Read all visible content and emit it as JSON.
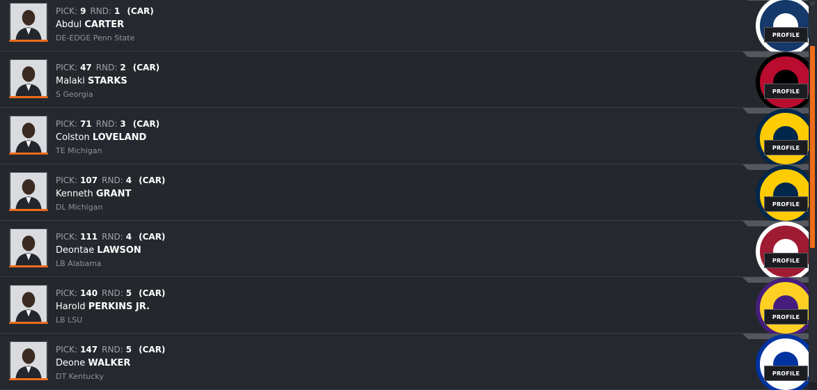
{
  "labels": {
    "pick": "PICK:",
    "round": "RND:",
    "profile": "PROFILE"
  },
  "picks": [
    {
      "pick": "9",
      "round": "1",
      "team": "(CAR)",
      "first": "Abdul",
      "last": "CARTER",
      "pos_school": "DE-EDGE Penn State",
      "logo_icon": "penn-state-logo-icon",
      "colors": {
        "primary": "#14396a",
        "secondary": "#ffffff"
      }
    },
    {
      "pick": "47",
      "round": "2",
      "team": "(CAR)",
      "first": "Malaki",
      "last": "STARKS",
      "pos_school": "S Georgia",
      "logo_icon": "georgia-logo-icon",
      "colors": {
        "primary": "#ba0c2f",
        "secondary": "#000000"
      }
    },
    {
      "pick": "71",
      "round": "3",
      "team": "(CAR)",
      "first": "Colston",
      "last": "LOVELAND",
      "pos_school": "TE Michigan",
      "logo_icon": "michigan-logo-icon",
      "colors": {
        "primary": "#ffcb05",
        "secondary": "#00274c"
      }
    },
    {
      "pick": "107",
      "round": "4",
      "team": "(CAR)",
      "first": "Kenneth",
      "last": "GRANT",
      "pos_school": "DL Michigan",
      "logo_icon": "michigan-logo-icon",
      "colors": {
        "primary": "#ffcb05",
        "secondary": "#00274c"
      }
    },
    {
      "pick": "111",
      "round": "4",
      "team": "(CAR)",
      "first": "Deontae",
      "last": "LAWSON",
      "pos_school": "LB Alabama",
      "logo_icon": "alabama-logo-icon",
      "colors": {
        "primary": "#9e1b32",
        "secondary": "#ffffff"
      }
    },
    {
      "pick": "140",
      "round": "5",
      "team": "(CAR)",
      "first": "Harold",
      "last": "PERKINS JR.",
      "pos_school": "LB LSU",
      "logo_icon": "lsu-logo-icon",
      "colors": {
        "primary": "#fdd023",
        "secondary": "#461d7c"
      }
    },
    {
      "pick": "147",
      "round": "5",
      "team": "(CAR)",
      "first": "Deone",
      "last": "WALKER",
      "pos_school": "DT Kentucky",
      "logo_icon": "kentucky-logo-icon",
      "colors": {
        "primary": "#ffffff",
        "secondary": "#0033a0"
      }
    }
  ],
  "theme": {
    "accent": "#ef6c1a",
    "background": "#25282e"
  }
}
